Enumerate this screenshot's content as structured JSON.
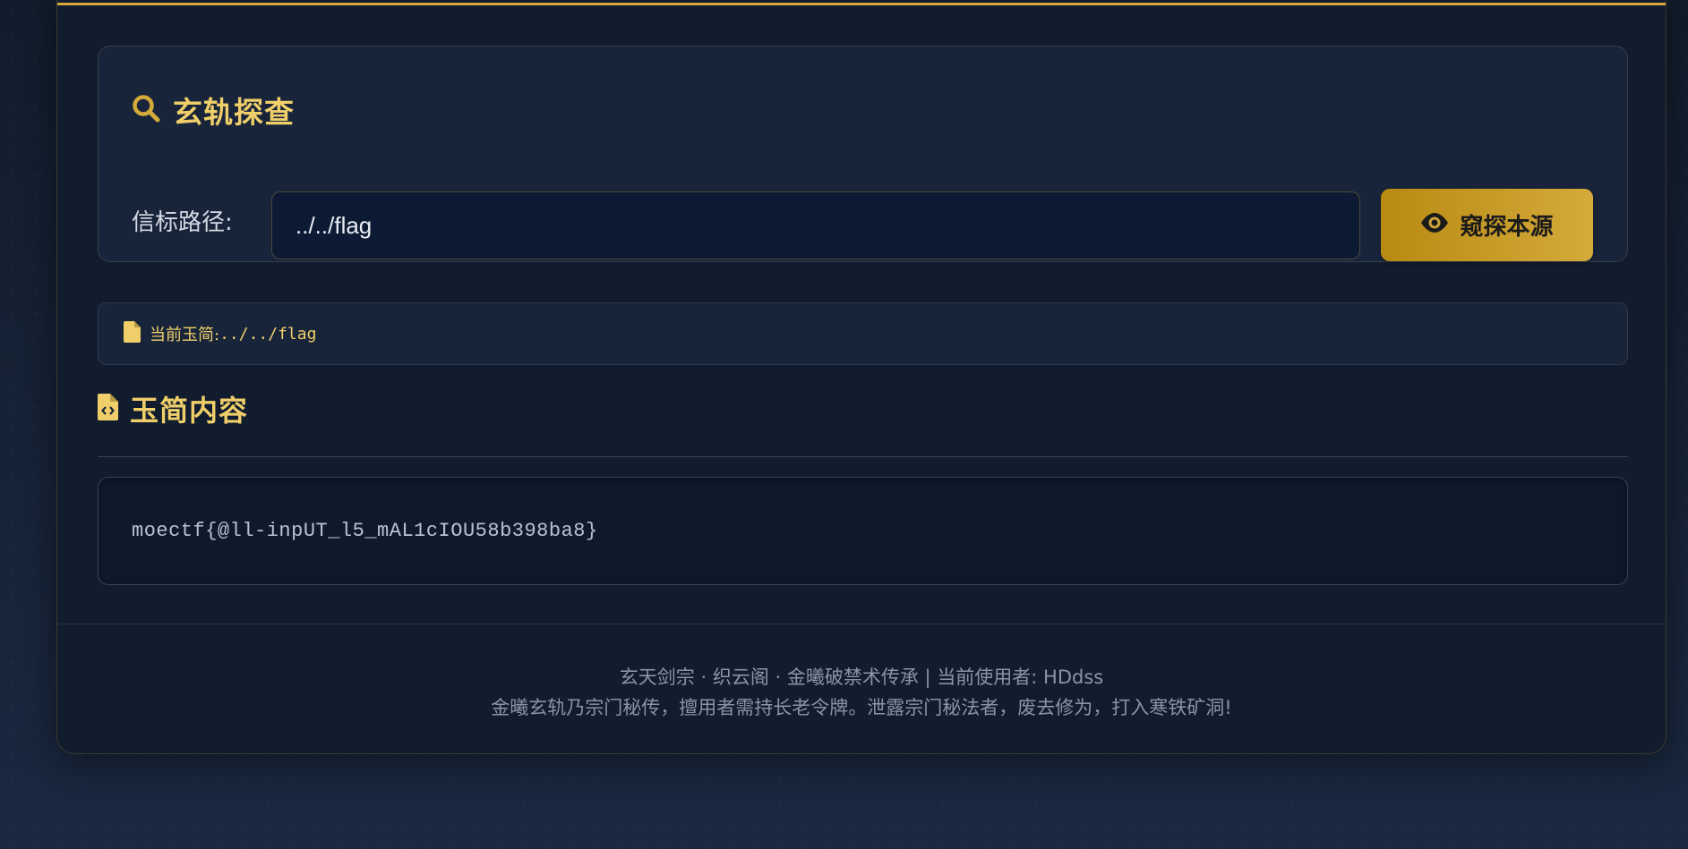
{
  "search": {
    "title": "玄轨探查",
    "path_label": "信标路径:",
    "path_value": "../../flag",
    "button_label": "窥探本源"
  },
  "current": {
    "label": "当前玉简:",
    "value": " ../../flag"
  },
  "content": {
    "title": "玉简内容",
    "text": "moectf{@ll-inpUT_l5_mAL1cIOU58b398ba8}"
  },
  "footer": {
    "line1": "玄天剑宗 · 织云阁 · 金曦破禁术传承 | 当前使用者: HDdss",
    "line2": "金曦玄轨乃宗门秘传，擅用者需持长老令牌。泄露宗门秘法者，废去修为，打入寒铁矿洞!"
  },
  "colors": {
    "accent": "#f0cf6a",
    "button_gold": "#d4aa3a",
    "background": "#111c2e"
  },
  "icons": {
    "search": "magnifier-icon",
    "eye": "eye-icon",
    "file": "file-icon",
    "file_code": "file-code-icon"
  }
}
